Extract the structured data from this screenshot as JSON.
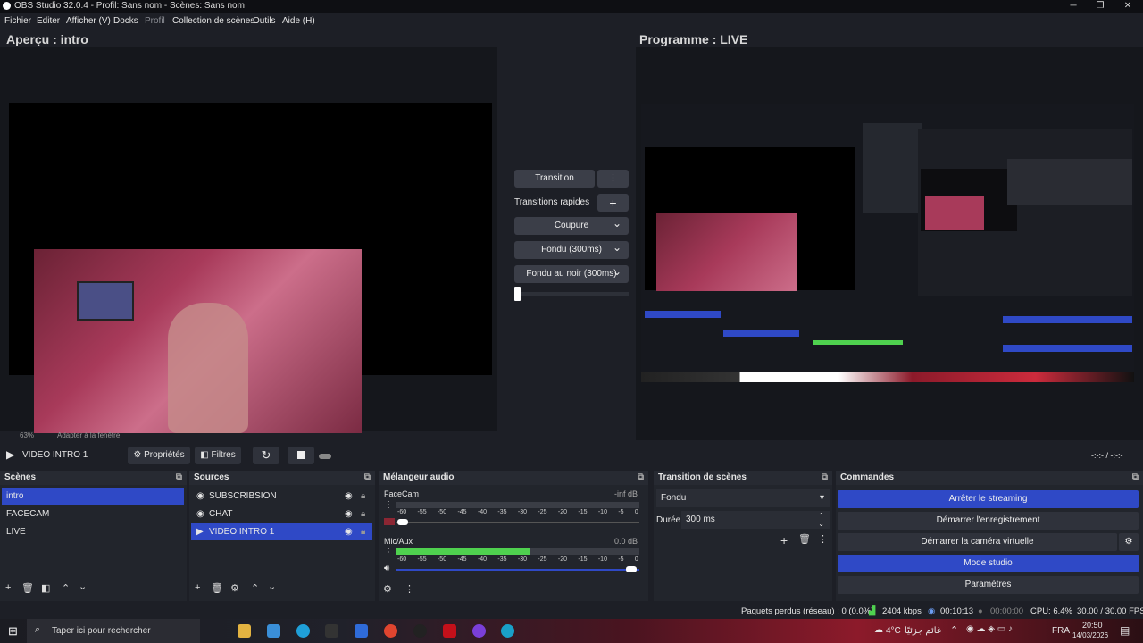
{
  "window": {
    "title": "OBS Studio 32.0.4 - Profil: Sans nom - Scènes: Sans nom",
    "minimize": "─",
    "maximize": "❐",
    "close": "✕"
  },
  "menu": [
    "Fichier",
    "Editer",
    "Afficher (V)",
    "Docks",
    "Profil",
    "Collection de scènes",
    "Outils",
    "Aide (H)"
  ],
  "preview": {
    "title": "Aperçu : intro",
    "zoom": "63%",
    "fit_label": "Adapter à la fenêtre"
  },
  "program": {
    "title": "Programme : LIVE"
  },
  "transitions": {
    "transition_btn": "Transition",
    "quick_label": "Transitions rapides",
    "items": [
      "Coupure",
      "Fondu (300ms)",
      "Fondu au noir (300ms)"
    ]
  },
  "playbar": {
    "source_name": "VIDEO INTRO 1",
    "properties": "Propriétés",
    "filters": "Filtres",
    "time": "-:-:-  /  -:-:-"
  },
  "scenes": {
    "title": "Scènes",
    "items": [
      "intro",
      "FACECAM",
      "LIVE"
    ]
  },
  "sources": {
    "title": "Sources",
    "items": [
      "SUBSCRIBSION",
      "CHAT",
      "VIDEO INTRO 1"
    ]
  },
  "mixer": {
    "title": "Mélangeur audio",
    "channels": [
      {
        "name": "FaceCam",
        "db": "-inf dB",
        "level": 0.0
      },
      {
        "name": "Mic/Aux",
        "db": "0.0 dB",
        "level": 0.55
      }
    ],
    "scale": [
      "-60",
      "-55",
      "-50",
      "-45",
      "-40",
      "-35",
      "-30",
      "-25",
      "-20",
      "-15",
      "-10",
      "-5",
      "0"
    ]
  },
  "scene_transition": {
    "title": "Transition de scènes",
    "type": "Fondu",
    "duration_label": "Durée",
    "duration_value": "300 ms"
  },
  "controls": {
    "title": "Commandes",
    "stop_stream": "Arrêter le streaming",
    "start_record": "Démarrer l'enregistrement",
    "virtual_cam": "Démarrer la caméra virtuelle",
    "studio_mode": "Mode studio",
    "settings": "Paramètres"
  },
  "status": {
    "dropped": "Paquets perdus (réseau) : 0 (0.0%)",
    "bitrate": "2404 kbps",
    "stream_time": "00:10:13",
    "record_time": "00:00:00",
    "cpu": "CPU: 6.4%",
    "fps": "30.00 / 30.00 FPS"
  },
  "taskbar": {
    "search_placeholder": "Taper ici pour rechercher",
    "weather": "4°C",
    "weather_text": "غائم جزئيًا",
    "lang": "FRA",
    "time": "20:50",
    "date": "14/03/2026"
  },
  "colors": {
    "accent": "#2f49c6",
    "meter_green": "#4fd14f"
  }
}
